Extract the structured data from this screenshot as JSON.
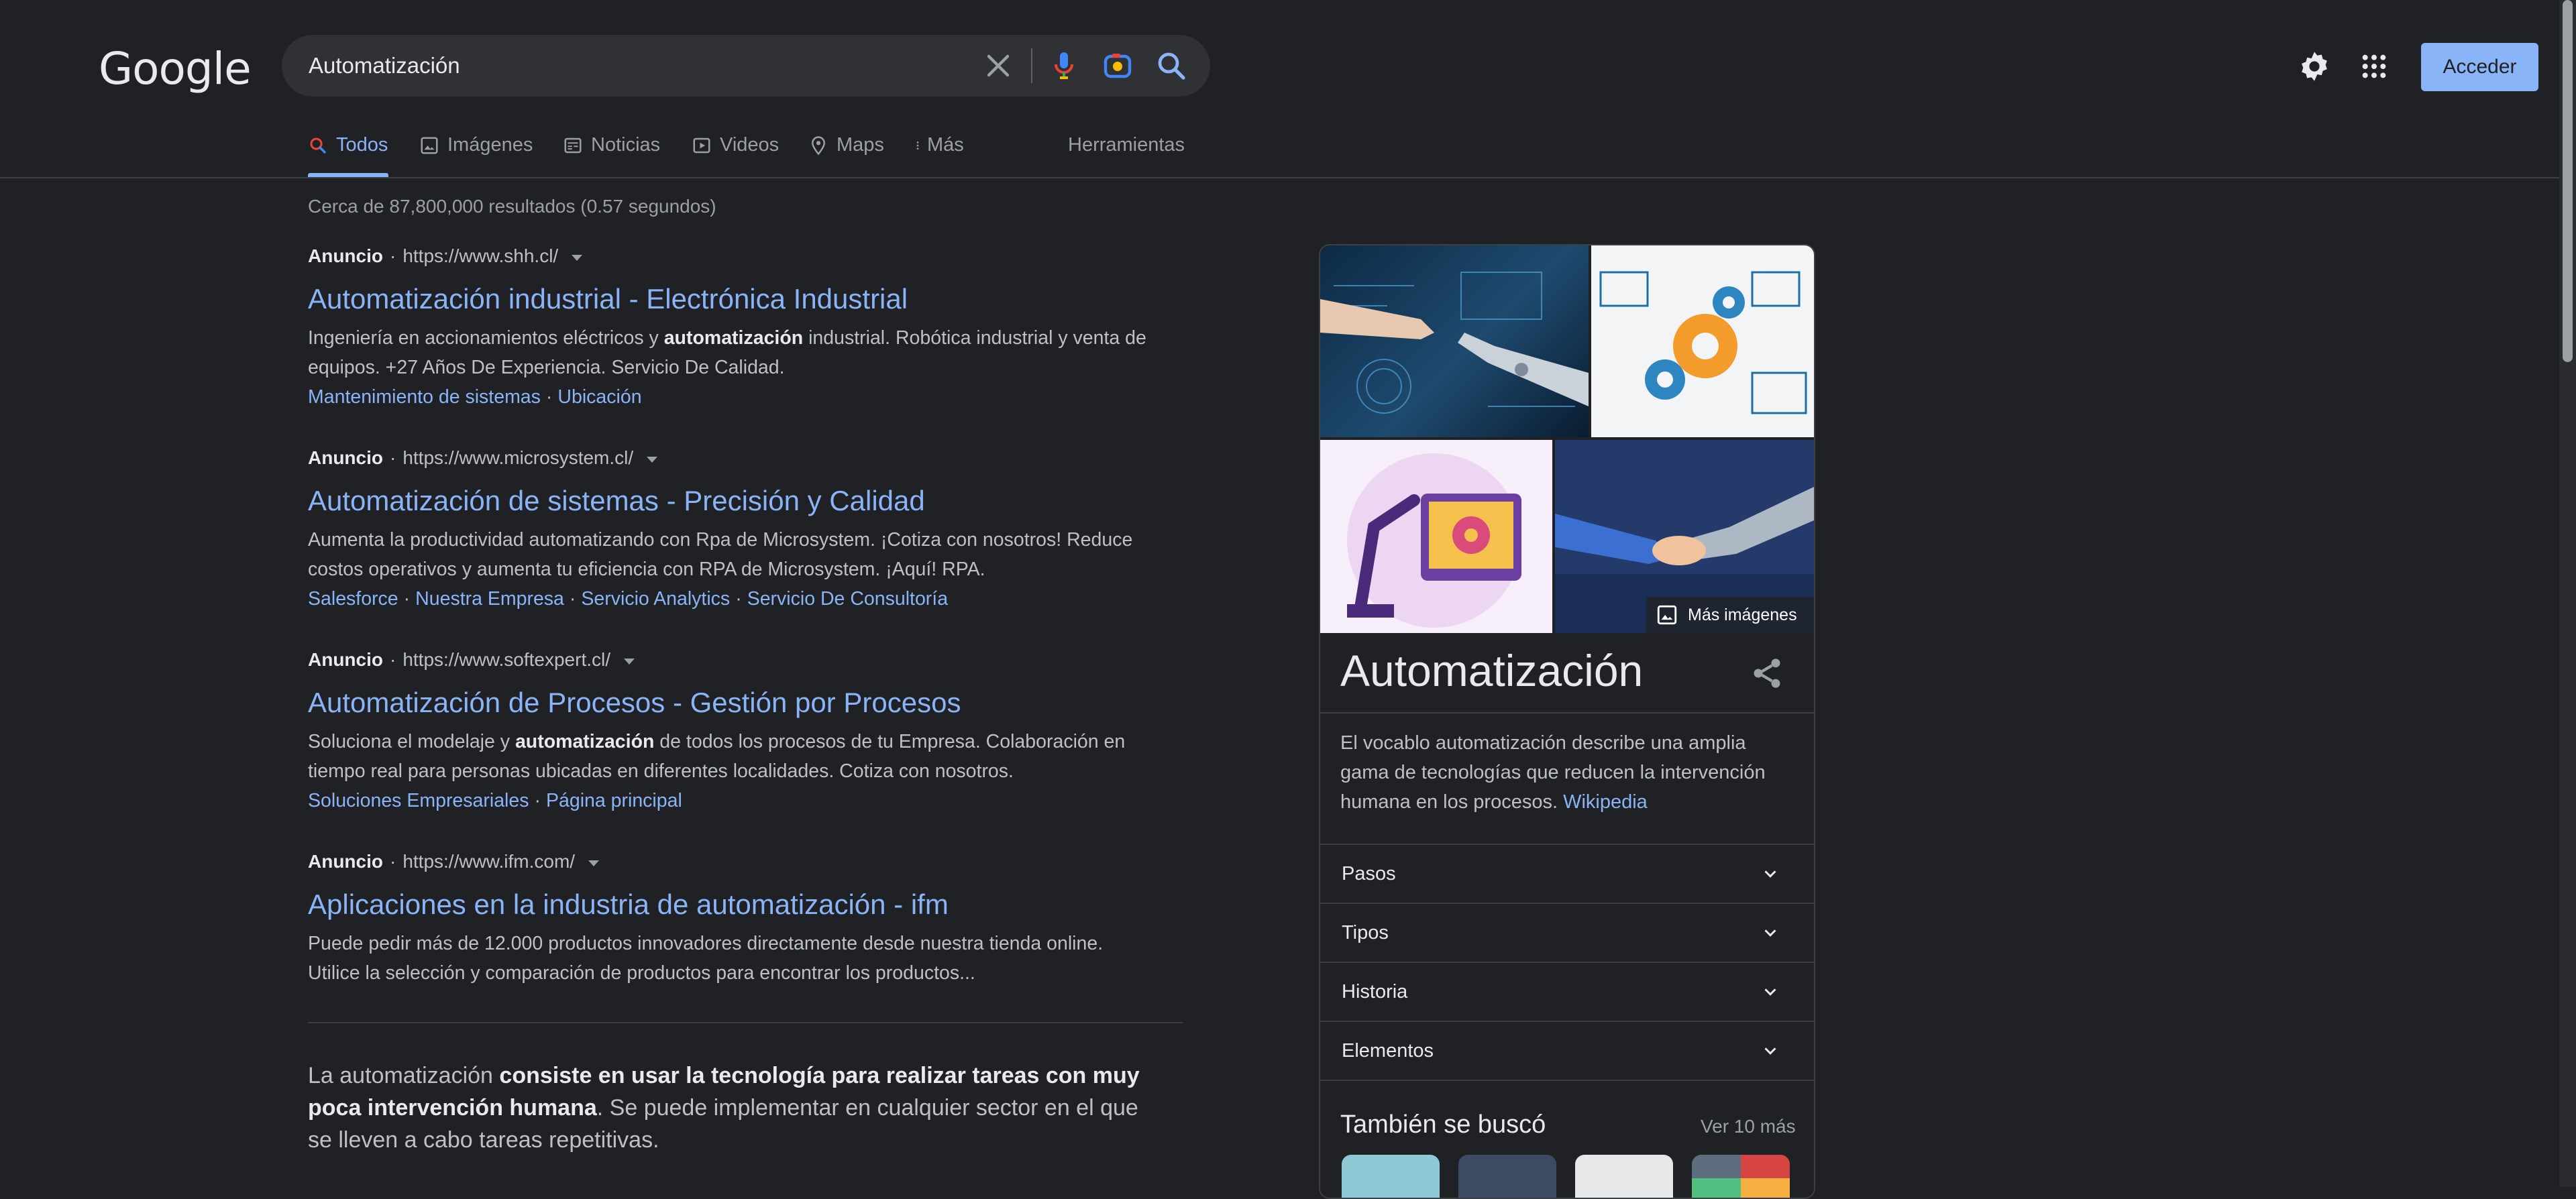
{
  "header": {
    "logo": "Google",
    "search_query": "Automatización",
    "signin_label": "Acceder"
  },
  "tabs": [
    {
      "label": "Todos"
    },
    {
      "label": "Imágenes"
    },
    {
      "label": "Noticias"
    },
    {
      "label": "Videos"
    },
    {
      "label": "Maps"
    },
    {
      "label": "Más"
    },
    {
      "label": "Herramientas"
    }
  ],
  "stats": "Cerca de 87,800,000 resultados (0.57 segundos)",
  "ads": [
    {
      "tag": "Anuncio",
      "url": "https://www.shh.cl/",
      "title": "Automatización industrial - Electrónica Industrial",
      "desc_pre": "Ingeniería en accionamientos eléctricos y ",
      "desc_bold": "automatización",
      "desc_post": " industrial. Robótica industrial y venta de equipos. +27 Años De Experiencia. Servicio De Calidad.",
      "links": [
        "Mantenimiento de sistemas",
        "Ubicación"
      ]
    },
    {
      "tag": "Anuncio",
      "url": "https://www.microsystem.cl/",
      "title": "Automatización de sistemas - Precisión y Calidad",
      "desc_pre": "Aumenta la productividad automatizando con Rpa de Microsystem. ¡Cotiza con nosotros! Reduce costos operativos y aumenta tu eficiencia con RPA de Microsystem. ¡Aquí! RPA.",
      "links": [
        "Salesforce",
        "Nuestra Empresa",
        "Servicio Analytics",
        "Servicio De Consultoría"
      ]
    },
    {
      "tag": "Anuncio",
      "url": "https://www.softexpert.cl/",
      "title": "Automatización de Procesos - Gestión por Procesos",
      "desc_pre": "Soluciona el modelaje y ",
      "desc_bold": "automatización",
      "desc_post": " de todos los procesos de tu Empresa. Colaboración en tiempo real para personas ubicadas en diferentes localidades. Cotiza con nosotros.",
      "links": [
        "Soluciones Empresariales",
        "Página principal"
      ]
    },
    {
      "tag": "Anuncio",
      "url": "https://www.ifm.com/",
      "title": "Aplicaciones en la industria de automatización - ifm",
      "desc_pre": "Puede pedir más de 12.000 productos innovadores directamente desde nuestra tienda online. Utilice la selección y comparación de productos para encontrar los productos..."
    }
  ],
  "featured": {
    "pre": "La automatización ",
    "bold": "consiste en usar la tecnología para realizar tareas con muy poca intervención humana",
    "post": ". Se puede implementar en cualquier sector en el que se lleven a cabo tareas repetitivas."
  },
  "kp": {
    "more_images": "Más imágenes",
    "title": "Automatización",
    "desc": "El vocablo automatización describe una amplia gama de tecnologías que reducen la intervención humana en los procesos.",
    "source": "Wikipedia",
    "accordions": [
      "Pasos",
      "Tipos",
      "Historia",
      "Elementos"
    ],
    "also_title": "También se buscó",
    "also_more": "Ver 10 más"
  },
  "colors": {
    "background": "#202124",
    "link": "#8ab4f8",
    "text": "#bdc1c6",
    "heading": "#e8eaed"
  },
  "icons": [
    "clear-icon",
    "mic-icon",
    "lens-icon",
    "search-icon",
    "settings-icon",
    "apps-icon",
    "share-icon",
    "chevron-down-icon",
    "image-icon"
  ]
}
